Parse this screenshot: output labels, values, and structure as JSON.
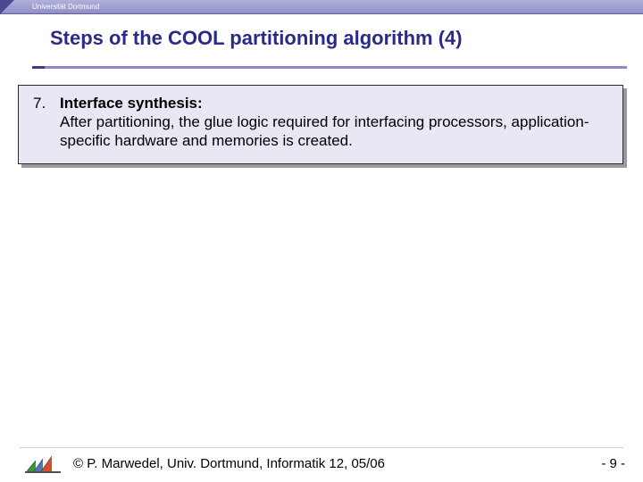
{
  "topbar": {
    "institution": "Universität Dortmund"
  },
  "title": "Steps of the COOL partitioning algorithm (4)",
  "item": {
    "number": "7.",
    "heading": "Interface synthesis",
    "text": "After partitioning, the glue logic required for interfacing processors, application-specific hardware and memories is created."
  },
  "footer": {
    "copyright": "© P. Marwedel, Univ. Dortmund, Informatik 12, 05/06",
    "page": "-  9 -"
  }
}
